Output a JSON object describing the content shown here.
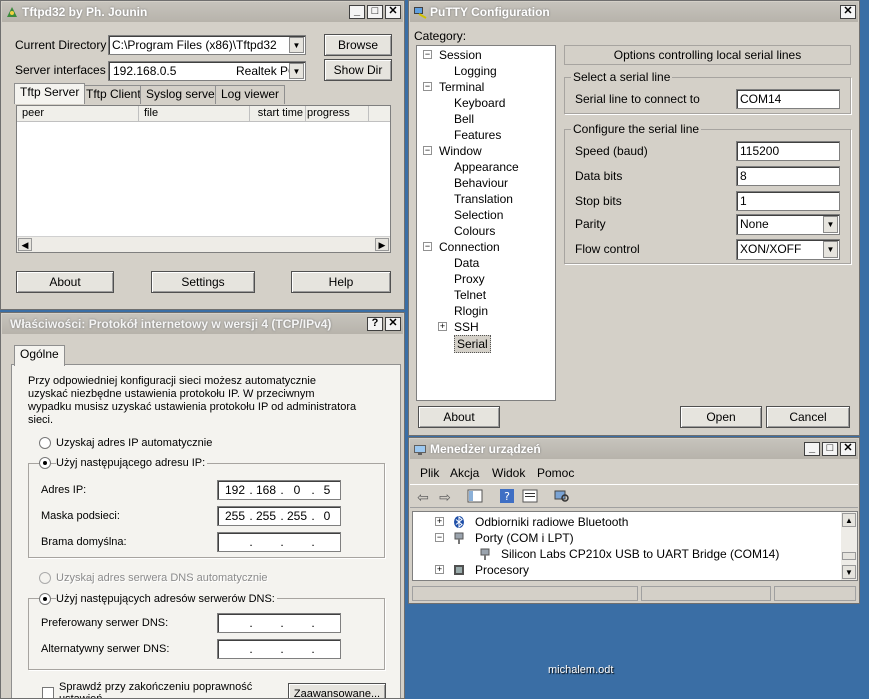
{
  "tftpd": {
    "title": "Tftpd32 by Ph. Jounin",
    "current_dir_label": "Current Directory",
    "current_dir_value": "C:\\Program Files (x86)\\Tftpd32",
    "browse_label": "Browse",
    "server_if_label": "Server interfaces",
    "server_if_ip": "192.168.0.5",
    "server_if_adapter": "Realtek PC",
    "showdir_label": "Show Dir",
    "tabs": [
      "Tftp Server",
      "Tftp Client",
      "Syslog server",
      "Log viewer"
    ],
    "columns": [
      "peer",
      "file",
      "start time",
      "progress"
    ],
    "about_label": "About",
    "settings_label": "Settings",
    "help_label": "Help"
  },
  "ipv4": {
    "title": "Właściwości: Protokół internetowy w wersji 4 (TCP/IPv4)",
    "tab": "Ogólne",
    "desc": "Przy odpowiedniej konfiguracji sieci możesz automatycznie uzyskać niezbędne ustawienia protokołu IP. W przeciwnym wypadku musisz uzyskać ustawienia protokołu IP od administratora sieci.",
    "auto_ip": "Uzyskaj adres IP automatycznie",
    "manual_ip": "Użyj następującego adresu IP:",
    "ip_label": "Adres IP:",
    "ip": [
      "192",
      "168",
      "0",
      "5"
    ],
    "mask_label": "Maska podsieci:",
    "mask": [
      "255",
      "255",
      "255",
      "0"
    ],
    "gateway_label": "Brama domyślna:",
    "auto_dns": "Uzyskaj adres serwera DNS automatycznie",
    "manual_dns": "Użyj następujących adresów serwerów DNS:",
    "pref_dns_label": "Preferowany serwer DNS:",
    "alt_dns_label": "Alternatywny serwer DNS:",
    "validate_label": "Sprawdź przy zakończeniu poprawność ustawień",
    "advanced_label": "Zaawansowane..."
  },
  "putty": {
    "title": "PuTTY Configuration",
    "category_label": "Category:",
    "tree": [
      {
        "label": "Session",
        "level": 0,
        "expander": "-"
      },
      {
        "label": "Logging",
        "level": 1,
        "expander": ""
      },
      {
        "label": "Terminal",
        "level": 0,
        "expander": "-"
      },
      {
        "label": "Keyboard",
        "level": 1,
        "expander": ""
      },
      {
        "label": "Bell",
        "level": 1,
        "expander": ""
      },
      {
        "label": "Features",
        "level": 1,
        "expander": ""
      },
      {
        "label": "Window",
        "level": 0,
        "expander": "-"
      },
      {
        "label": "Appearance",
        "level": 1,
        "expander": ""
      },
      {
        "label": "Behaviour",
        "level": 1,
        "expander": ""
      },
      {
        "label": "Translation",
        "level": 1,
        "expander": ""
      },
      {
        "label": "Selection",
        "level": 1,
        "expander": ""
      },
      {
        "label": "Colours",
        "level": 1,
        "expander": ""
      },
      {
        "label": "Connection",
        "level": 0,
        "expander": "-"
      },
      {
        "label": "Data",
        "level": 1,
        "expander": ""
      },
      {
        "label": "Proxy",
        "level": 1,
        "expander": ""
      },
      {
        "label": "Telnet",
        "level": 1,
        "expander": ""
      },
      {
        "label": "Rlogin",
        "level": 1,
        "expander": ""
      },
      {
        "label": "SSH",
        "level": 1,
        "expander": "+"
      },
      {
        "label": "Serial",
        "level": 1,
        "expander": "",
        "selected": true
      }
    ],
    "panel_header": "Options controlling local serial lines",
    "select_group": "Select a serial line",
    "serial_line_label": "Serial line to connect to",
    "serial_line_value": "COM14",
    "config_group": "Configure the serial line",
    "speed_label": "Speed (baud)",
    "speed_value": "115200",
    "databits_label": "Data bits",
    "databits_value": "8",
    "stopbits_label": "Stop bits",
    "stopbits_value": "1",
    "parity_label": "Parity",
    "parity_value": "None",
    "flow_label": "Flow control",
    "flow_value": "XON/XOFF",
    "about_label": "About",
    "open_label": "Open",
    "cancel_label": "Cancel"
  },
  "devmgr": {
    "title": "Menedżer urządzeń",
    "menu": [
      "Plik",
      "Akcja",
      "Widok",
      "Pomoc"
    ],
    "items": [
      {
        "label": "Odbiorniki radiowe Bluetooth",
        "expander": "+"
      },
      {
        "label": "Porty (COM i LPT)",
        "expander": "-"
      },
      {
        "label": "Silicon Labs CP210x USB to UART Bridge (COM14)",
        "expander": ""
      },
      {
        "label": "Procesory",
        "expander": "+"
      }
    ]
  },
  "desktop": {
    "background_text": "michalem.odt"
  }
}
